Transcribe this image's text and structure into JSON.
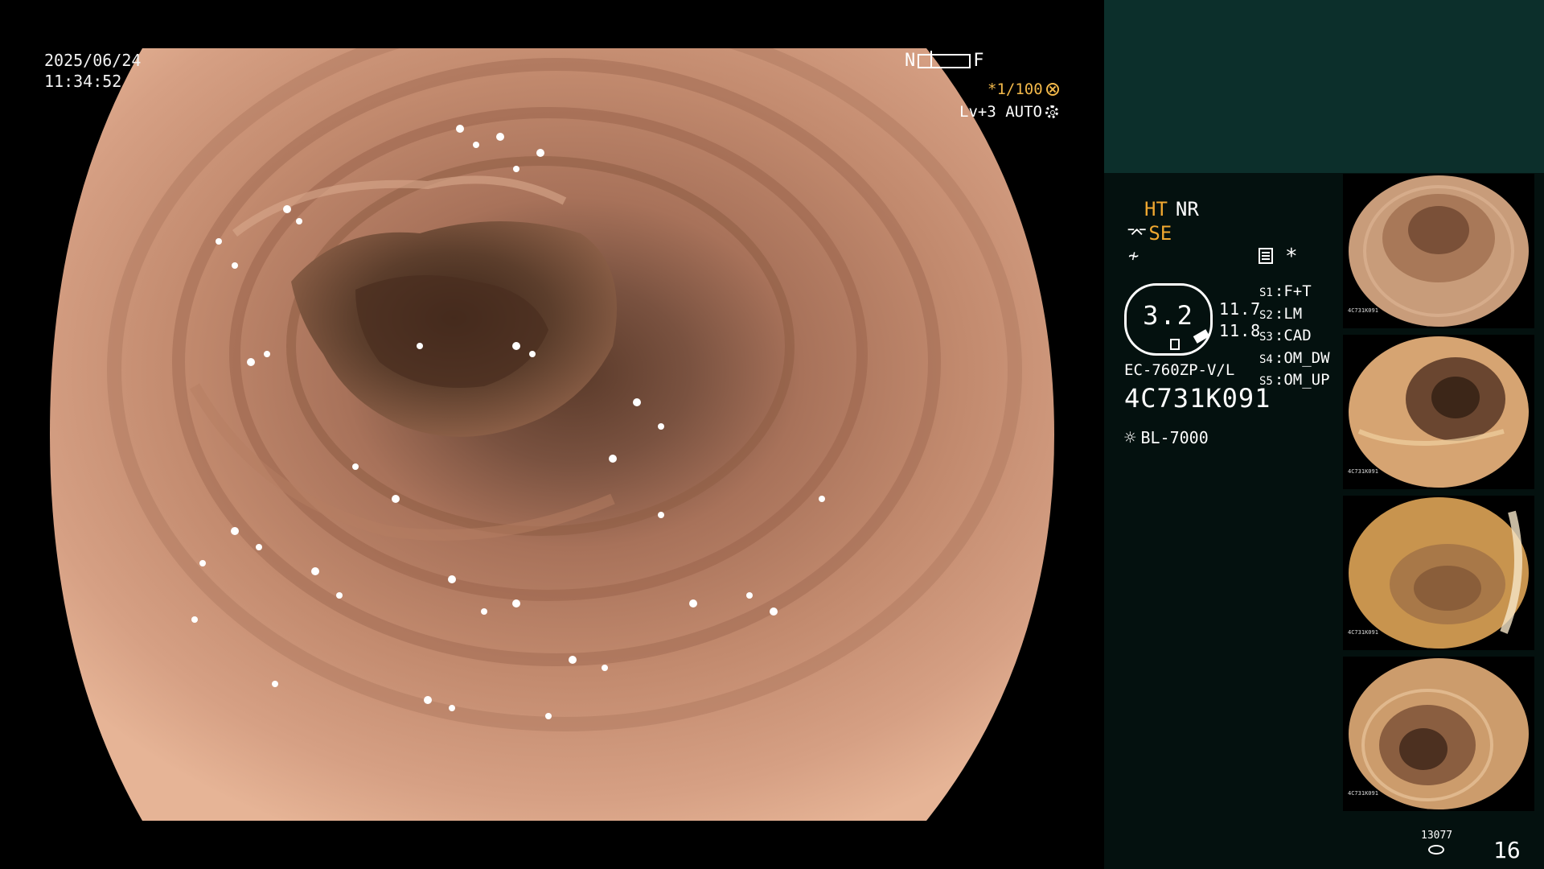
{
  "overlay": {
    "date": "2025/06/24",
    "time": "11:34:52",
    "nf_near": "N",
    "nf_far": "F",
    "zoom": "*1/100",
    "level": "Lv+3 AUTO"
  },
  "panel": {
    "ht": "HT",
    "nr": "NR",
    "se": "SE",
    "gauge_value": "3.2",
    "value_1": "11.7",
    "value_2": "11.8",
    "slots": [
      {
        "key": "S1",
        "value": "F+T"
      },
      {
        "key": "S2",
        "value": "LM"
      },
      {
        "key": "S3",
        "value": "CAD"
      },
      {
        "key": "S4",
        "value": "OM_DW"
      },
      {
        "key": "S5",
        "value": "OM_UP"
      }
    ],
    "scope_model": "EC-760ZP-V/L",
    "scope_serial": "4C731K091",
    "light_source": "BL-7000",
    "counter_small": "13077",
    "counter_big": "16"
  },
  "thumbnails": [
    {
      "serial": "4C731K091",
      "tone": "#c49a78"
    },
    {
      "serial": "4C731K091",
      "tone": "#d4a070"
    },
    {
      "serial": "4C731K091",
      "tone": "#c8954f"
    },
    {
      "serial": "4C731K091",
      "tone": "#c89868"
    }
  ],
  "colors": {
    "accent_orange": "#f0a830",
    "panel_teal": "#0c2f2b",
    "mucosa": "#c08468"
  }
}
